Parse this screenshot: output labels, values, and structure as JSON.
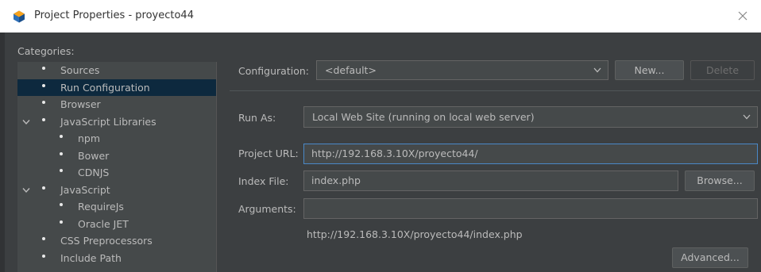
{
  "window": {
    "title": "Project Properties - proyecto44"
  },
  "categories": {
    "label": "Categories:",
    "items": [
      {
        "label": "Sources"
      },
      {
        "label": "Run Configuration"
      },
      {
        "label": "Browser"
      },
      {
        "label": "JavaScript Libraries"
      },
      {
        "label": "npm"
      },
      {
        "label": "Bower"
      },
      {
        "label": "CDNJS"
      },
      {
        "label": "JavaScript"
      },
      {
        "label": "RequireJs"
      },
      {
        "label": "Oracle JET"
      },
      {
        "label": "CSS Preprocessors"
      },
      {
        "label": "Include Path"
      }
    ]
  },
  "configuration": {
    "label": "Configuration:",
    "value": "<default>",
    "new_label": "New...",
    "delete_label": "Delete"
  },
  "run_as": {
    "label": "Run As:",
    "value": "Local Web Site (running on local web server)"
  },
  "project_url": {
    "label": "Project URL:",
    "value": "http://192.168.3.10X/proyecto44/"
  },
  "index_file": {
    "label": "Index File:",
    "value": "index.php",
    "browse_label": "Browse..."
  },
  "arguments": {
    "label": "Arguments:",
    "value": ""
  },
  "resolved_url": "http://192.168.3.10X/proyecto44/index.php",
  "advanced_label": "Advanced...",
  "colors": {
    "selection": "#0d293e",
    "focus_border": "#4a88c7",
    "panel": "#3c3f41"
  }
}
